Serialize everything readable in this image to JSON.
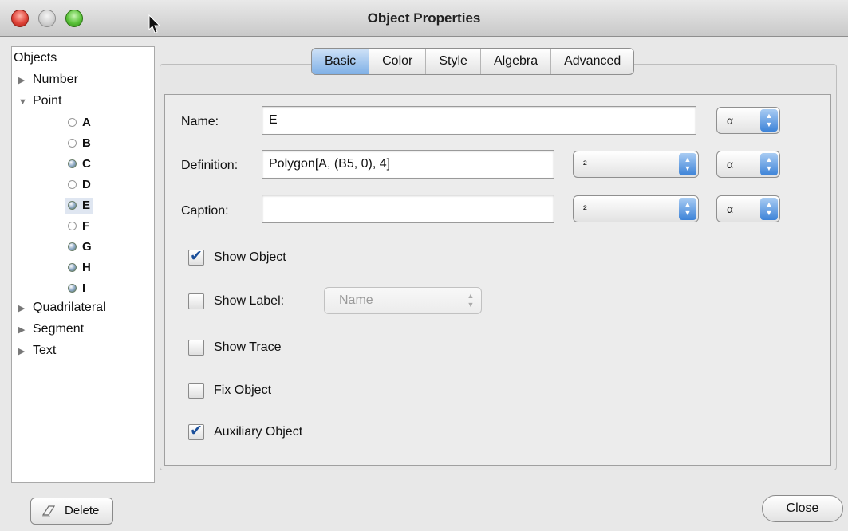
{
  "window": {
    "title": "Object Properties"
  },
  "tree": {
    "root": "Objects",
    "groups": [
      {
        "label": "Number",
        "expanded": false
      },
      {
        "label": "Point",
        "expanded": true
      },
      {
        "label": "Quadrilateral",
        "expanded": false
      },
      {
        "label": "Segment",
        "expanded": false
      },
      {
        "label": "Text",
        "expanded": false
      }
    ],
    "points": [
      {
        "label": "A",
        "visible": false
      },
      {
        "label": "B",
        "visible": false
      },
      {
        "label": "C",
        "visible": true
      },
      {
        "label": "D",
        "visible": false
      },
      {
        "label": "E",
        "visible": true,
        "selected": true
      },
      {
        "label": "F",
        "visible": false
      },
      {
        "label": "G",
        "visible": true
      },
      {
        "label": "H",
        "visible": true
      },
      {
        "label": "I",
        "visible": true
      }
    ]
  },
  "tabs": [
    {
      "label": "Basic",
      "active": true
    },
    {
      "label": "Color"
    },
    {
      "label": "Style"
    },
    {
      "label": "Algebra"
    },
    {
      "label": "Advanced"
    }
  ],
  "form": {
    "name_label": "Name:",
    "name_value": "E",
    "definition_label": "Definition:",
    "definition_value": "Polygon[A, (B5, 0), 4]",
    "caption_label": "Caption:",
    "caption_value": "",
    "alpha_symbol": "α",
    "superscript_symbol": "²"
  },
  "checkboxes": {
    "show_object": {
      "label": "Show Object",
      "checked": true
    },
    "show_label": {
      "label": "Show Label:",
      "checked": false,
      "option": "Name"
    },
    "show_trace": {
      "label": "Show Trace",
      "checked": false
    },
    "fix_object": {
      "label": "Fix Object",
      "checked": false
    },
    "auxiliary_object": {
      "label": "Auxiliary Object",
      "checked": true
    }
  },
  "buttons": {
    "delete_label": "Delete",
    "close_label": "Close"
  }
}
